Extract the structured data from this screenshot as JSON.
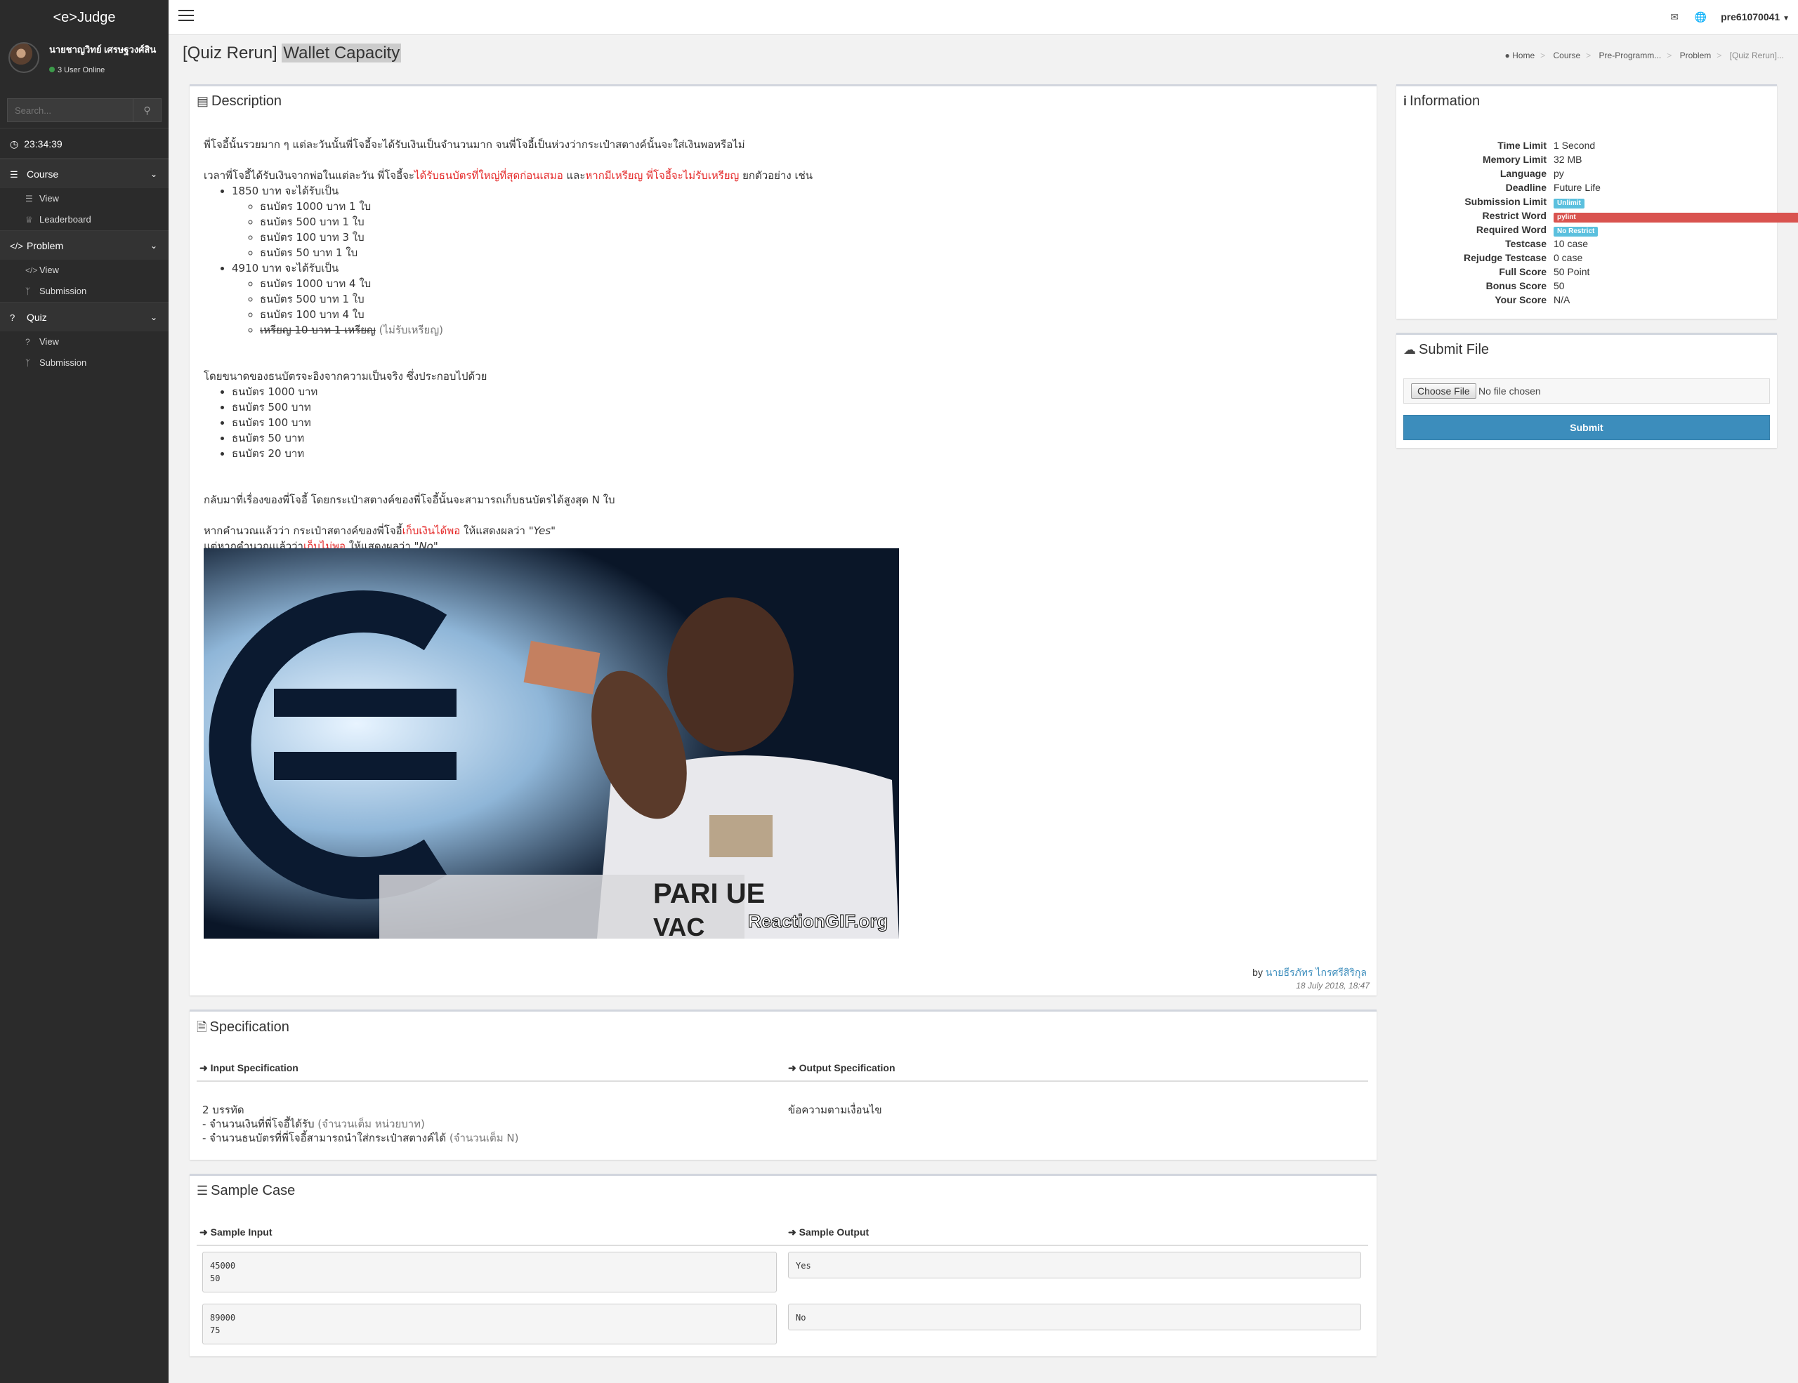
{
  "brand": "<e>Judge",
  "user": {
    "name": "นายชาญวิทย์ เศรษฐวงศ์สิน",
    "status": "3 User Online"
  },
  "search": {
    "placeholder": "Search..."
  },
  "clock": "23:34:39",
  "sidebar": {
    "course": {
      "label": "Course",
      "items": [
        "View",
        "Leaderboard"
      ]
    },
    "problem": {
      "label": "Problem",
      "items": [
        "View",
        "Submission"
      ]
    },
    "quiz": {
      "label": "Quiz",
      "items": [
        "View",
        "Submission"
      ]
    }
  },
  "topbar": {
    "username": "pre61070041"
  },
  "page": {
    "title_prefix": "[Quiz Rerun] ",
    "title_highlight": "Wallet Capacity"
  },
  "breadcrumb": [
    "Home",
    "Course",
    "Pre-Programm...",
    "Problem",
    "[Quiz Rerun]..."
  ],
  "description": {
    "title": "Description",
    "p1": "พี่โจอี้นั้นรวยมาก ๆ แต่ละวันนั้นพี่โจอี้จะได้รับเงินเป็นจำนวนมาก จนพี่โจอี้เป็นห่วงว่ากระเป๋าสตางค์นั้นจะใส่เงินพอหรือไม่",
    "p2_a": "เวลาพี่โจอี้ได้รับเงินจากพ่อในแต่ละวัน พี่โจอี้จะ",
    "p2_red1": "ได้รับธนบัตรที่ใหญ่ที่สุดก่อนเสมอ",
    "p2_b": " และ",
    "p2_red2": "หากมีเหรียญ พี่โจอี้จะไม่รับเหรียญ",
    "p2_c": " ยกตัวอย่าง เช่น",
    "ex1": "1850 บาท จะได้รับเป็น",
    "ex1_items": [
      "ธนบัตร 1000 บาท 1 ใบ",
      "ธนบัตร 500 บาท 1 ใบ",
      "ธนบัตร 100 บาท 3 ใบ",
      "ธนบัตร 50 บาท 1 ใบ"
    ],
    "ex2": "4910 บาท จะได้รับเป็น",
    "ex2_items": [
      "ธนบัตร 1000 บาท 4 ใบ",
      "ธนบัตร 500 บาท 1 ใบ",
      "ธนบัตร 100 บาท 4 ใบ"
    ],
    "ex2_strike": "เหรียญ 10 บาท 1 เหรียญ",
    "ex2_note": " (ไม่รับเหรียญ)",
    "p3": "โดยขนาดของธนบัตรจะอิงจากความเป็นจริง ซึ่งประกอบไปด้วย",
    "notes": [
      "ธนบัตร 1000 บาท",
      "ธนบัตร 500 บาท",
      "ธนบัตร 100 บาท",
      "ธนบัตร 50 บาท",
      "ธนบัตร 20 บาท"
    ],
    "p4": "กลับมาที่เรื่องของพี่โจอี้ โดยกระเป๋าสตางค์ของพี่โจอี้นั้นจะสามารถเก็บธนบัตรได้สูงสุด N ใบ",
    "p5_a": "หากคำนวณแล้วว่า กระเป๋าสตางค์ของพี่โจอี้",
    "p5_red": "เก็บเงินได้พอ",
    "p5_b": " ให้แสดงผลว่า ",
    "p5_q": "\"Yes\"",
    "p6_a": "แต่หากคำนวณแล้วว่า",
    "p6_red": "เก็บไม่พอ",
    "p6_b": " ให้แสดงผลว่า ",
    "p6_q": "\"No\"",
    "image_text_1": "ReactionGIF.org",
    "image_text_2": "PARI  UE",
    "image_text_3": "VAC",
    "by_prefix": "by ",
    "author": "นายธีรภัทร ไกรศรีสิริกุล",
    "date": "18 July 2018, 18:47"
  },
  "information": {
    "title": "Information",
    "rows": [
      {
        "label": "Time Limit",
        "value": "1 Second"
      },
      {
        "label": "Memory Limit",
        "value": "32 MB"
      },
      {
        "label": "Language",
        "value": "py"
      },
      {
        "label": "Deadline",
        "value": "Future Life"
      },
      {
        "label": "Submission Limit",
        "badge": "Unlimit"
      },
      {
        "label": "Restrict Word",
        "badge": "pylint"
      },
      {
        "label": "Required Word",
        "badge": "No Restrict"
      },
      {
        "label": "Testcase",
        "value": "10 case"
      },
      {
        "label": "Rejudge Testcase",
        "value": "0 case"
      },
      {
        "label": "Full Score",
        "value": "50 Point"
      },
      {
        "label": "Bonus Score",
        "value": "50"
      },
      {
        "label": "Your Score",
        "value": "N/A"
      }
    ],
    "colors": {
      "info": "#5bc0de",
      "danger": "#d9534f"
    }
  },
  "submit": {
    "title": "Submit File",
    "choose": "Choose File",
    "nofile": "No file chosen",
    "button": "Submit"
  },
  "specification": {
    "title": "Specification",
    "input_title": "Input Specification",
    "output_title": "Output Specification",
    "input_line1": "2 บรรทัด",
    "input_line2": "- จำนวนเงินที่พี่โจอี้ได้รับ",
    "input_line2_note": " (จำนวนเต็ม หน่วยบาท)",
    "input_line3": "- จำนวนธนบัตรที่พี่โจอี้สามารถนำใส่กระเป๋าสตางค์ได้",
    "input_line3_note": " (จำนวนเต็ม N)",
    "output_text": "ข้อความตามเงื่อนไข"
  },
  "sample": {
    "title": "Sample Case",
    "input_title": "Sample Input",
    "output_title": "Sample Output",
    "cases": [
      {
        "input": "45000\n50",
        "output": "Yes"
      },
      {
        "input": "89000\n75",
        "output": "No"
      }
    ]
  }
}
